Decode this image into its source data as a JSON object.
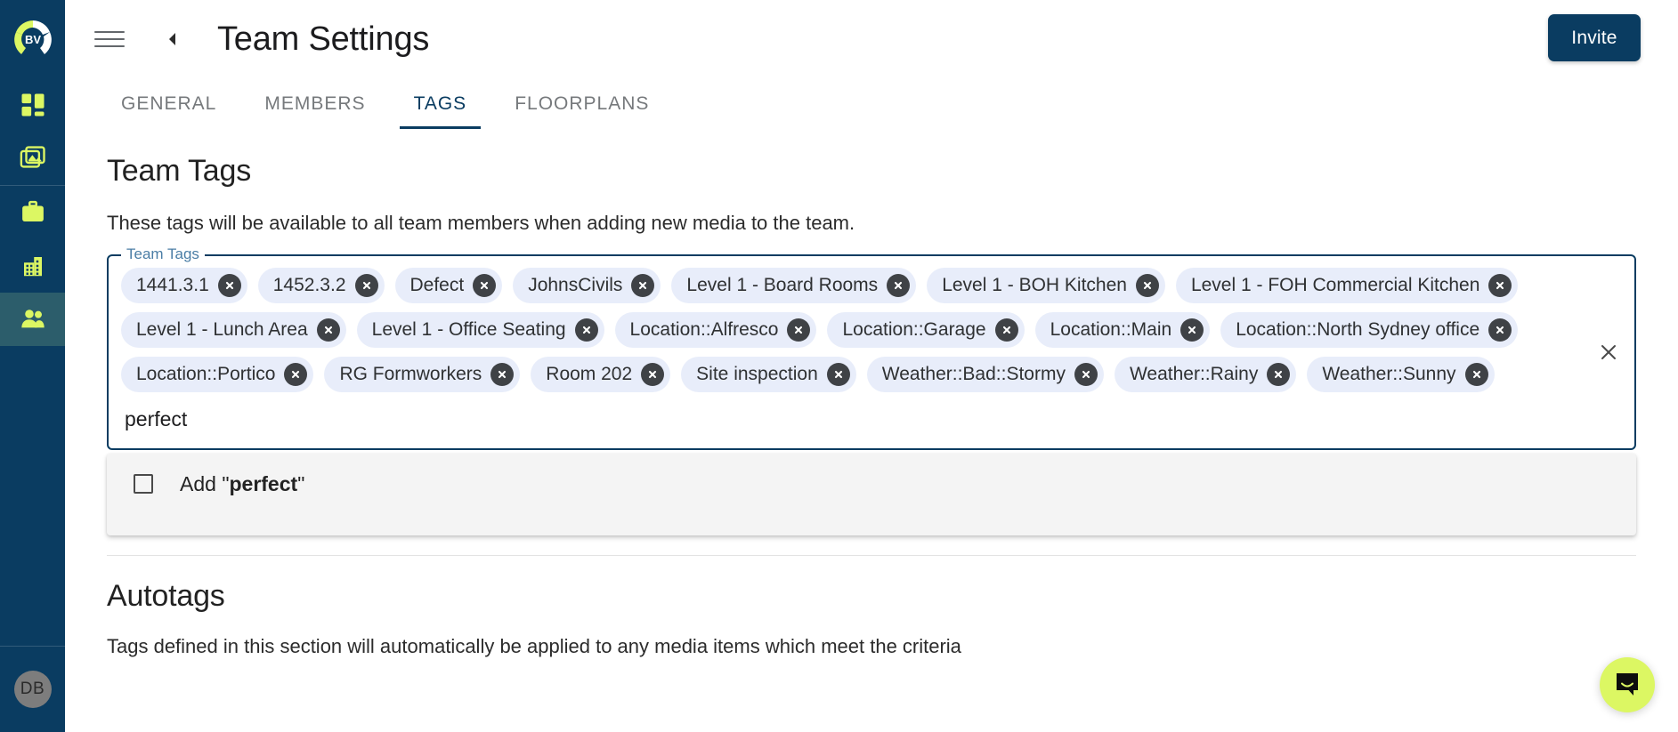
{
  "colors": {
    "sidebar_bg": "#0a3c61",
    "accent_lime": "#dcf763",
    "brand_navy": "#0a3c61",
    "chip_bg": "#e8edfa",
    "chip_delete": "#3f4246",
    "active_nav_bg": "#2c5d6b"
  },
  "sidebar": {
    "logo_text": "BV",
    "items": [
      {
        "name": "dashboard",
        "icon": "grid-icon",
        "active": false
      },
      {
        "name": "media",
        "icon": "photos-icon",
        "active": false
      },
      {
        "name": "projects",
        "icon": "briefcase-icon",
        "active": false
      },
      {
        "name": "company",
        "icon": "building-icon",
        "active": false
      },
      {
        "name": "teams",
        "icon": "people-icon",
        "active": true
      }
    ],
    "avatar_initials": "DB"
  },
  "header": {
    "menu_icon": "hamburger-icon",
    "back_icon": "chevron-left-icon",
    "title": "Team Settings",
    "invite_label": "Invite"
  },
  "tabs": [
    {
      "label": "GENERAL",
      "active": false
    },
    {
      "label": "MEMBERS",
      "active": false
    },
    {
      "label": "TAGS",
      "active": true
    },
    {
      "label": "FLOORPLANS",
      "active": false
    }
  ],
  "team_tags": {
    "heading": "Team Tags",
    "description": "These tags will be available to all team members when adding new media to the team.",
    "field_legend": "Team Tags",
    "input_value": "perfect",
    "input_placeholder": "",
    "clear_all_icon": "close-icon",
    "chips": [
      "1441.3.1",
      "1452.3.2",
      "Defect",
      "JohnsCivils",
      "Level 1 - Board Rooms",
      "Level 1 - BOH Kitchen",
      "Level 1 - FOH Commercial Kitchen",
      "Level 1 - Lunch Area",
      "Level 1 - Office Seating",
      "Location::Alfresco",
      "Location::Garage",
      "Location::Main",
      "Location::North Sydney office",
      "Location::Portico",
      "RG Formworkers",
      "Room 202",
      "Site inspection",
      "Weather::Bad::Stormy",
      "Weather::Rainy",
      "Weather::Sunny"
    ]
  },
  "dropdown": {
    "option_prefix": "Add \"",
    "option_value": "perfect",
    "option_suffix": "\"",
    "checkbox_checked": false
  },
  "autotags": {
    "heading": "Autotags",
    "description": "Tags defined in this section will automatically be applied to any media items which meet the criteria"
  },
  "chat_widget": {
    "icon": "chat-bubble-icon"
  }
}
